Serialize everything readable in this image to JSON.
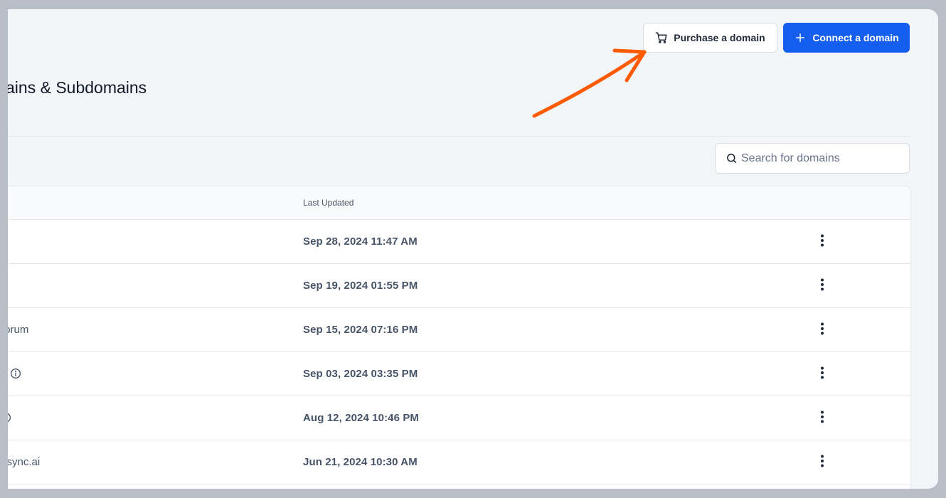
{
  "header": {
    "purchase_label": "Purchase a domain",
    "connect_label": "Connect a domain"
  },
  "page": {
    "title": "ains & Subdomains"
  },
  "search": {
    "placeholder": "Search for domains"
  },
  "table": {
    "columns": {
      "last_updated": "Last Updated"
    },
    "rows": [
      {
        "name": "",
        "info": false,
        "updated": "Sep 28, 2024 11:47 AM"
      },
      {
        "name": "",
        "info": false,
        "updated": "Sep 19, 2024 01:55 PM"
      },
      {
        "name": "forum",
        "info": false,
        "updated": "Sep 15, 2024 07:16 PM"
      },
      {
        "name": "",
        "info": true,
        "updated": "Sep 03, 2024 03:35 PM"
      },
      {
        "name": "",
        "info": true,
        "updated": "Aug 12, 2024 10:46 PM"
      },
      {
        "name": "ksync.ai",
        "info": false,
        "updated": "Jun 21, 2024 10:30 AM"
      }
    ]
  },
  "colors": {
    "primary": "#155eef",
    "annotation_arrow": "#ff5a00",
    "background": "#f2f6f9"
  },
  "icons": {
    "purchase": "cart-icon",
    "connect": "plus-icon",
    "search": "search-icon",
    "row_menu": "kebab-menu-icon",
    "info": "info-icon"
  }
}
